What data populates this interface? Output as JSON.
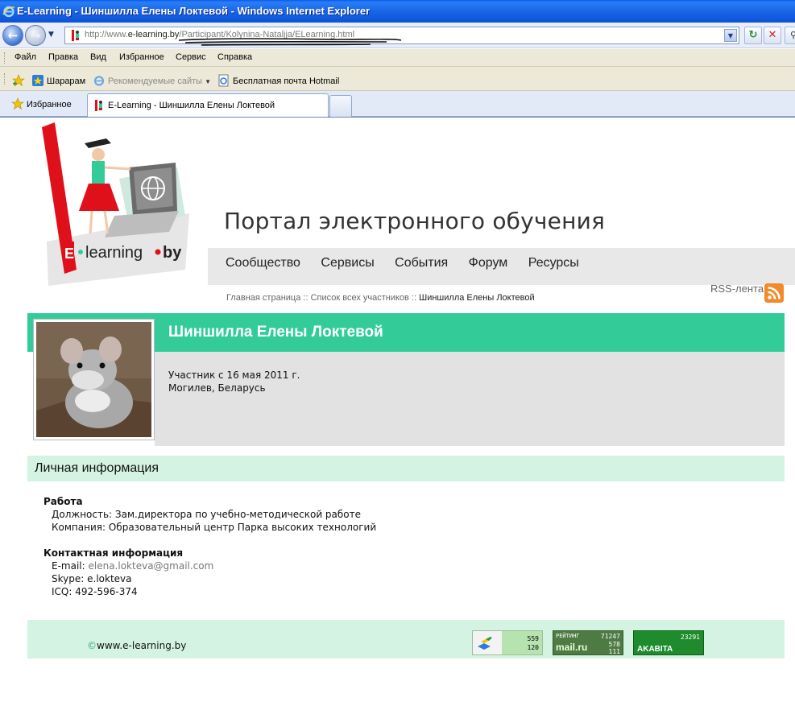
{
  "window": {
    "title": "E-Learning - Шиншилла Елены Локтевой - Windows Internet Explorer",
    "url_prefix": "http://www.",
    "url_domain": "e-learning.by",
    "url_path": "/Participant/Kolynina-Nataljja/ELearning.html"
  },
  "menu": [
    "Файл",
    "Правка",
    "Вид",
    "Избранное",
    "Сервис",
    "Справка"
  ],
  "favorites_bar": {
    "sharaam": "Шарарам",
    "recommended": "Рекомендуемые сайты",
    "hotmail": "Бесплатная почта Hotmail"
  },
  "tabs": {
    "favorites_label": "Избранное",
    "active_tab": "E-Learning - Шиншилла Елены Локтевой"
  },
  "site": {
    "logo_text_e": "E",
    "logo_text_learning": "learning",
    "logo_text_by": "by",
    "portal_title": "Портал электронного обучения",
    "nav": [
      "Сообщество",
      "Сервисы",
      "События",
      "Форум",
      "Ресурсы"
    ],
    "breadcrumb": {
      "home": "Главная страница",
      "sep": " :: ",
      "participants": "Список всех участников",
      "current": "Шиншилла Елены Локтевой"
    },
    "rss_label": "RSS-лента"
  },
  "profile": {
    "name": "Шиншилла Елены Локтевой",
    "member_since": "Участник с 16 мая 2011 г.",
    "location": "Могилев, Беларусь"
  },
  "personal": {
    "section_title": "Личная информация",
    "work_heading": "Работа",
    "position_label": "Должность:",
    "position_value": "Зам.директора по учебно-методической работе",
    "company_label": "Компания:",
    "company_value": "Образовательный центр Парка высоких технологий",
    "contact_heading": "Контактная информация",
    "email_label": "E-mail:",
    "email_value": "elena.lokteva@gmail.com",
    "skype_label": "Skype:",
    "skype_value": "e.lokteva",
    "icq_label": "ICQ:",
    "icq_value": "492-596-374"
  },
  "footer": {
    "copyright_symbol": "©",
    "site": "www.e-learning.by",
    "counter1": {
      "top": "559",
      "bottom": "120"
    },
    "counter2": {
      "label": "РЕЙТИНГ",
      "brand": "mail.ru",
      "a": "71247",
      "b": "578",
      "c": "111"
    },
    "counter3": {
      "value": "23291",
      "brand": "AKABITA"
    }
  },
  "colors": {
    "header_green": "#33cc99",
    "section_green": "#d5f3e2",
    "logo_red": "#e0101a"
  }
}
